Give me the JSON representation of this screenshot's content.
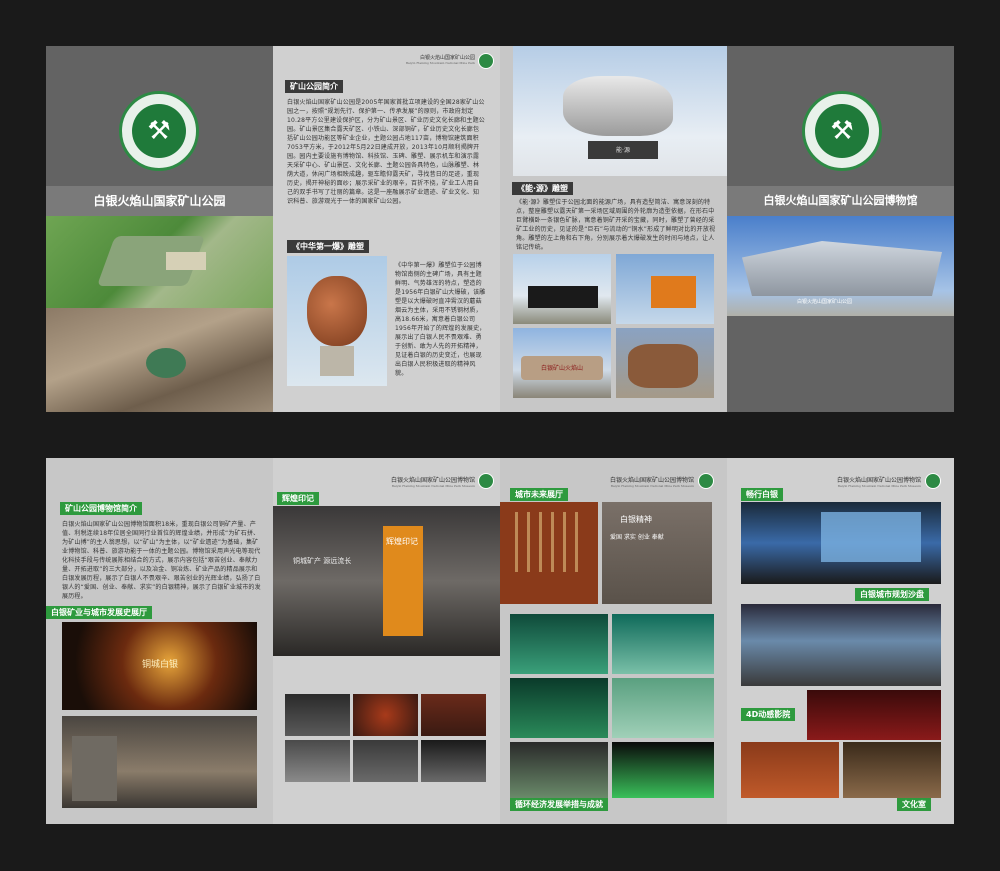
{
  "top": {
    "panel1": {
      "park_title": "白银火焰山国家矿山公园"
    },
    "panel2": {
      "mini_header": "白银火焰山国家矿山公园",
      "mini_header_en": "Baiyin Flaming Mountain National Mine Park",
      "section1_title": "矿山公园简介",
      "section1_text": "白银火焰山国家矿山公园是2005年国家首批立项建设的全国28家矿山公园之一，按照“规划先行、保护第一、传承发展”的原则，市政府划定10.28平方公里建设保护区，分为矿山景区、矿业历史文化长廊和主题公园。矿山景区集合露天矿区、小铁山、深部铜矿，矿业历史文化长廊包括矿山公园功能区等矿业企业，主题公园占地117亩，博物馆建筑面积7053平方米，于2012年5月22日建成开放，2013年10月顺利揭牌开园。园内主要设施有博物馆、科技馆、玉碑、雕塑、展示机车和演示露天采矿中心、矿山景区、文化长廊、主题公园各具特色，山脉雕塑、林荫大道，休闲广场相映成趣，驱车瞻仰露天矿，寻找昔日的足迹，重现历史，揭开神秘的面纱；展示采矿业的艰辛，百折不挠，矿业工人用自己的双手书写了壮丽的篇章。这是一座融展示矿业遗迹、矿业文化、知识科普、旅游观光于一体的国家矿山公园。",
      "section2_title": "《中华第一爆》雕塑",
      "section2_text": "《中华第一爆》雕塑位于公园博物馆南侧的主碑广场，具有主题鲜明、气势雄浑的特点，塑造的是1956年白银矿山大爆破，该雕塑是以大爆破时直冲霄汉的蘑菇烟云为主体，采用不锈钢材质，高18.66米，寓意着白银公司1956年开始了的辉煌的发展史，展示出了白银人民不畏艰难、勇于创新、敢为人先的开拓精神，见证着白银的历史变迁，也展现出白银人民积极进取的精神风貌。"
    },
    "panel3": {
      "section_title": "《能·源》雕塑",
      "section_text": "《能·源》雕塑位于公园北面的能源广场，具有造型简洁、寓意深刻的特点，整座雕塑以露天矿第一采场区域周围的外轮廓为造型依据，在形石中巨臂横卧一条银色矿脉，寓意着铜矿开采的宝藏，同时，雕塑了曾经的采矿工业的历史，见证的是“巨石”与流动的“铜水”形成了鲜明对比的开放视角。雕塑的左上角和右下角，分别展示着大爆破发生的时间与地点，让人铭记传统。",
      "plaque_text": "能·源",
      "cart_sign": "白银矿山火焰山"
    },
    "panel4": {
      "museum_title": "白银火焰山国家矿山公园博物馆",
      "museum_sign": "白银火焰山国家矿山公园"
    }
  },
  "bottom": {
    "header_cn": "白银火焰山国家矿山公园博物馆",
    "header_en": "Baiyin Flaming Mountain National Mine Park Museum",
    "panel1": {
      "intro_title": "矿山公园博物馆简介",
      "intro_text": "白银火焰山国家矿山公园博物馆面积18米，重现白银公司铜矿产量、产值、利税连续18年位居全国同行业首位的辉煌业绩，并形成“为矿石拼、为矿山搏”的主人翁思想，以“矿山”为主体，以“矿业遗迹”为基础，集矿业博物馆、科普、旅游功能于一体的主题公园。博物馆采用声光电等现代化科技手段与传统展陈相结合的方式，展示内容包括“艰苦创业、奉献力量、开拓进取”的三大部分，以及冶金、铜冶炼、矿业产品的精品展示和白银发展历程，展示了白银人不畏艰辛、艰苦创业的光辉业绩，弘扬了白银人的“爱国、创业、奉献、求实”的白银精神，展示了白银矿业城市的发展历程。",
      "section_title": "白银矿业与城市发展史展厅",
      "screen_text": "铜城白银"
    },
    "panel2": {
      "section_title": "辉煌印记",
      "wall_text": "铜城矿产 源远流长",
      "banner_text": "辉煌印记"
    },
    "panel3": {
      "section_title": "城市未来展厅",
      "spirit_title": "白银精神",
      "spirit_line1": "爱国 求实 创业 奉献",
      "section_footer": "循环经济发展举措与成就"
    },
    "panel4": {
      "section_title": "畅行白银",
      "sand_table": "白银城市规划沙盘",
      "cinema": "4D动感影院",
      "culture": "文化室"
    }
  },
  "colors": {
    "accent_green": "#2e9a3e",
    "panel_gray": "#c8c8c8",
    "dark_gray": "#5e5e5e"
  }
}
